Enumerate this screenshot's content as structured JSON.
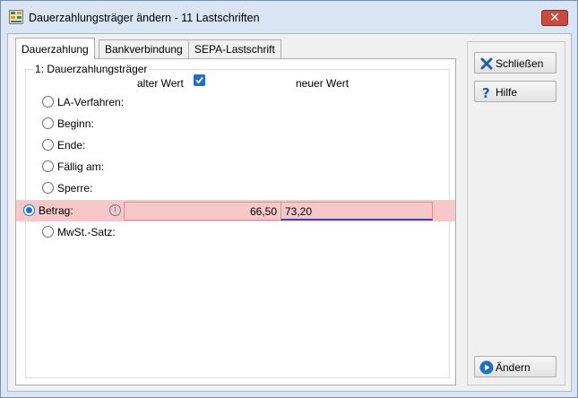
{
  "window": {
    "title": "Dauerzahlungsträger ändern - 11 Lastschriften",
    "close_glyph": "✕"
  },
  "tabs": [
    {
      "label": "Dauerzahlung",
      "active": true
    },
    {
      "label": "Bankverbindung",
      "active": false
    },
    {
      "label": "SEPA-Lastschrift",
      "active": false
    }
  ],
  "group": {
    "label": "1: Dauerzahlungsträger",
    "old_header": "alter Wert",
    "new_header": "neuer Wert",
    "old_checkbox_checked": true
  },
  "rows": [
    {
      "label": "LA-Verfahren:",
      "selected": false
    },
    {
      "label": "Beginn:",
      "selected": false
    },
    {
      "label": "Ende:",
      "selected": false
    },
    {
      "label": "Fällig am:",
      "selected": false
    },
    {
      "label": "Sperre:",
      "selected": false
    },
    {
      "label": "Betrag:",
      "selected": true,
      "old_value": "66,50",
      "new_value": "73,20",
      "info_glyph": "i"
    },
    {
      "label": "MwSt.-Satz:",
      "selected": false
    }
  ],
  "buttons": {
    "close": {
      "label": "Schließen",
      "icon": "close-x-icon"
    },
    "help": {
      "label": "Hilfe",
      "icon": "question-icon"
    },
    "change": {
      "label": "Ändern",
      "icon": "play-circle-icon"
    }
  },
  "colors": {
    "selected_row": "#f8c7c9",
    "accent_blue": "#1f6fc5",
    "close_red": "#c74b3e"
  }
}
